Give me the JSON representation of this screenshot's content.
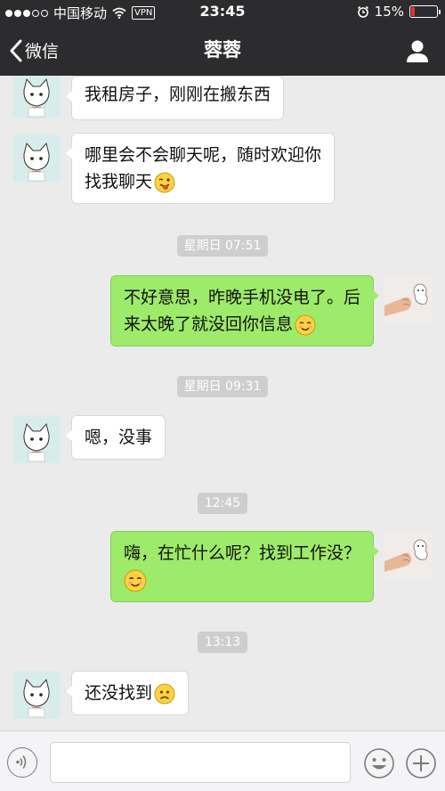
{
  "status_bar": {
    "carrier": "中国移动",
    "vpn": "VPN",
    "time": "23:45",
    "battery": "15%",
    "battery_level": 0.15
  },
  "nav": {
    "back_label": "微信",
    "title": "蓉蓉"
  },
  "messages": [
    {
      "text": "我租房子，刚刚在搬东西"
    },
    {
      "text": "哪里会不会聊天呢，随时欢迎你",
      "text2": "找我聊天",
      "emoji": "tongue-wink-emoji"
    },
    {
      "timestamp": "星期日 07:51"
    },
    {
      "text": "不好意思，昨晚手机没电了。后",
      "text2": "来太晚了就没回你信息",
      "emoji": "blush-emoji"
    },
    {
      "timestamp": "星期日 09:31"
    },
    {
      "text": "嗯，没事"
    },
    {
      "timestamp": "12:45"
    },
    {
      "text": "嗨，在忙什么呢？找到工作没？",
      "emoji": "blush-emoji"
    },
    {
      "timestamp": "13:13"
    },
    {
      "text": "还没找到",
      "emoji": "frown-emoji"
    }
  ],
  "colors": {
    "header": "#2c2c2e",
    "chat_bg": "#ebebeb",
    "outgoing_bubble": "#9eea6a",
    "incoming_bubble": "#ffffff"
  }
}
